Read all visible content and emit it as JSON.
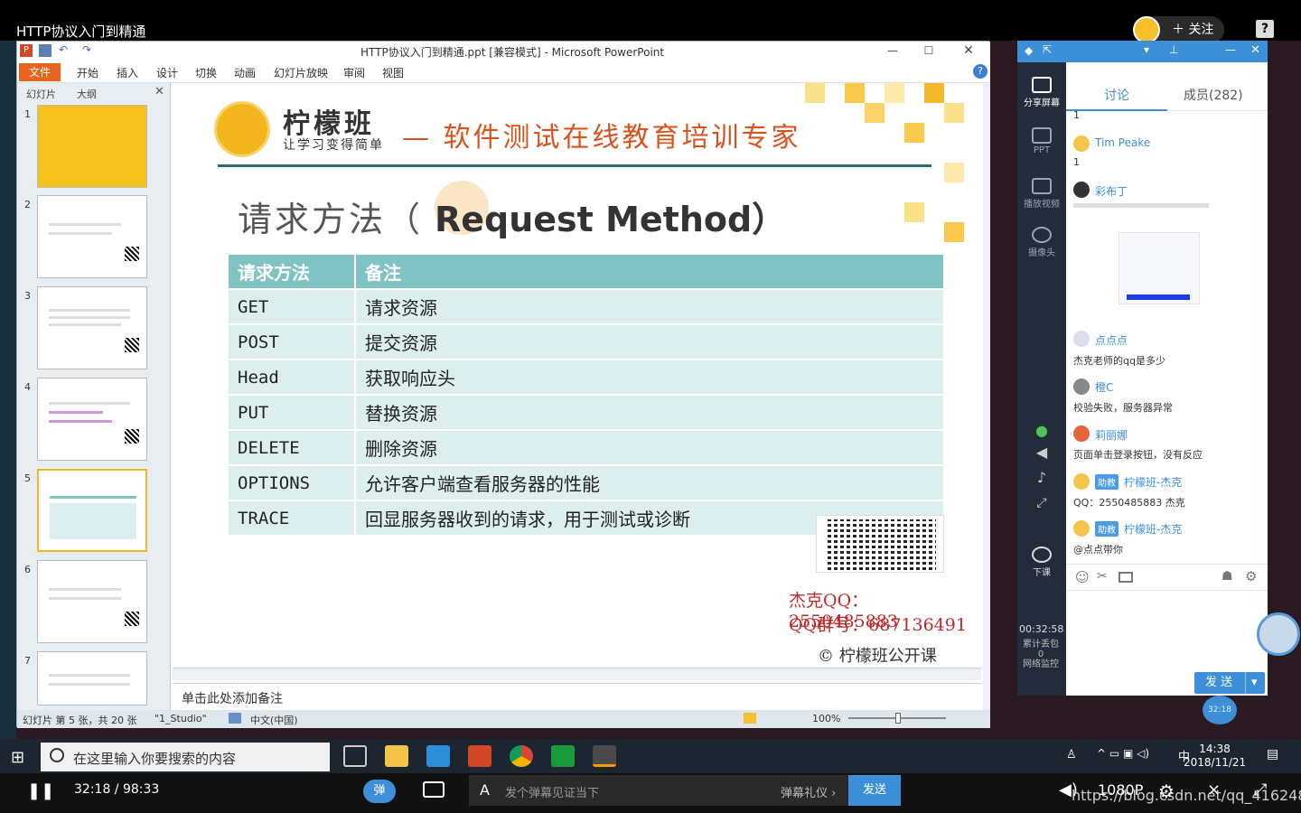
{
  "player": {
    "video_title": "HTTP协议入门到精通",
    "follow_label": "关注",
    "time_display": "32:18 / 98:33",
    "danmu_toggle": "弹",
    "danmu_placeholder": "发个弹幕见证当下",
    "danmu_gift": "弹幕礼仪 ›",
    "danmu_send": "发送",
    "quality": "1080P",
    "watermark": "https://blog.csdn.net/qq_41624890"
  },
  "ppt": {
    "window_title": "HTTP协议入门到精通.ppt [兼容模式] - Microsoft PowerPoint",
    "menu": [
      "文件",
      "开始",
      "插入",
      "设计",
      "切换",
      "动画",
      "幻灯片放映",
      "审阅",
      "视图"
    ],
    "side_tabs": [
      "幻灯片",
      "大纲"
    ],
    "thumb_numbers": [
      "1",
      "2",
      "3",
      "4",
      "5",
      "6",
      "7"
    ],
    "notes_placeholder": "单击此处添加备注",
    "status": {
      "slide_info": "幻灯片 第 5 张，共 20 张",
      "theme": "\"1_Studio\"",
      "language": "中文(中国)",
      "zoom": "100%"
    }
  },
  "slide": {
    "logo_text": "柠檬班",
    "logo_sub": "让学习变得简单",
    "slogan": "— 软件测试在线教育培训专家",
    "heading_cn": "请求方法（",
    "heading_en": "Request Method）",
    "table_headers": [
      "请求方法",
      "备注"
    ],
    "rows": [
      {
        "method": "GET",
        "note": "请求资源"
      },
      {
        "method": "POST",
        "note": "提交资源"
      },
      {
        "method": "Head",
        "note": "获取响应头"
      },
      {
        "method": "PUT",
        "note": "替换资源"
      },
      {
        "method": "DELETE",
        "note": "删除资源"
      },
      {
        "method": "OPTIONS",
        "note": "允许客户端查看服务器的性能"
      },
      {
        "method": "TRACE",
        "note": "回显服务器收到的请求，用于测试或诊断"
      }
    ],
    "contact_qq": "杰克QQ：2550485883",
    "contact_group": "QQ群号：687136491",
    "copyright": "© 柠檬班公开课"
  },
  "classroom": {
    "tools": [
      "分享屏幕",
      "PPT",
      "播放视频",
      "摄像头"
    ],
    "end_class": "下课",
    "timer": "00:32:58",
    "packet_loss": "累计丢包\n0\n网络监控",
    "tabs": {
      "discuss": "讨论",
      "members": "成员(282)"
    },
    "messages": [
      {
        "name": "",
        "text": "1"
      },
      {
        "name": "Tim Peake",
        "text": "1"
      },
      {
        "name": "彩布丁",
        "text": ""
      },
      {
        "name": "点点点",
        "text": "杰克老师的qq是多少"
      },
      {
        "name": "橙C",
        "text": "校验失败，服务器异常"
      },
      {
        "name": "莉丽娜",
        "text": "页面单击登录按钮，没有反应"
      },
      {
        "name": "柠檬班-杰克",
        "badge": "助教",
        "text": "QQ：2550485883 杰克"
      },
      {
        "name": "柠檬班-杰克",
        "badge": "助教",
        "text": "@点点带你"
      }
    ],
    "send_label": "发 送",
    "float_time": "32:18"
  },
  "taskbar": {
    "search_placeholder": "在这里输入你要搜索的内容",
    "ime": "中",
    "time": "14:38",
    "date": "2018/11/21"
  }
}
